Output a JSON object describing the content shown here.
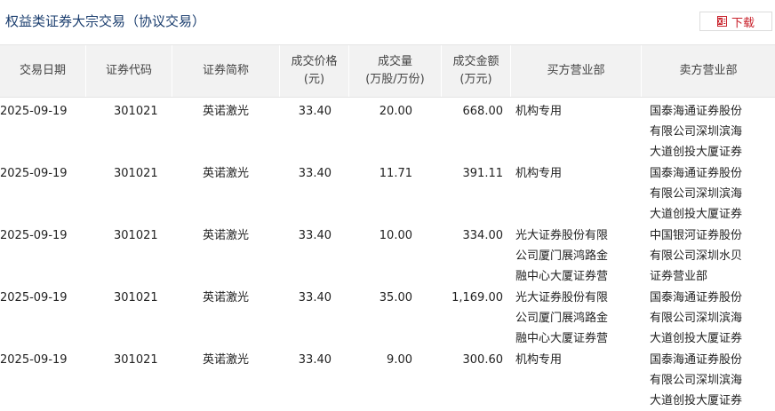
{
  "page": {
    "title": "权益类证券大宗交易（协议交易）"
  },
  "toolbar": {
    "download_label": "下载",
    "download_icon": "excel-file-icon",
    "accent": "#c8202a"
  },
  "table": {
    "headers": [
      [
        "交易日期"
      ],
      [
        "证券代码"
      ],
      [
        "证券简称"
      ],
      [
        "成交价格",
        "(元)"
      ],
      [
        "成交量",
        "(万股/万份)"
      ],
      [
        "成交金额",
        "(万元)"
      ],
      [
        "买方营业部"
      ],
      [
        "卖方营业部"
      ]
    ],
    "rows": [
      {
        "date": "2025-09-19",
        "code": "301021",
        "name": "英诺激光",
        "price": "33.40",
        "volume": "20.00",
        "amount": "668.00",
        "buyer": [
          "机构专用"
        ],
        "seller": [
          "国泰海通证券股份",
          "有限公司深圳滨海",
          "大道创投大厦证券"
        ]
      },
      {
        "date": "2025-09-19",
        "code": "301021",
        "name": "英诺激光",
        "price": "33.40",
        "volume": "11.71",
        "amount": "391.11",
        "buyer": [
          "机构专用"
        ],
        "seller": [
          "国泰海通证券股份",
          "有限公司深圳滨海",
          "大道创投大厦证券"
        ]
      },
      {
        "date": "2025-09-19",
        "code": "301021",
        "name": "英诺激光",
        "price": "33.40",
        "volume": "10.00",
        "amount": "334.00",
        "buyer": [
          "光大证券股份有限",
          "公司厦门展鸿路金",
          "融中心大厦证券营"
        ],
        "seller": [
          "中国银河证券股份",
          "有限公司深圳水贝",
          "证券营业部"
        ]
      },
      {
        "date": "2025-09-19",
        "code": "301021",
        "name": "英诺激光",
        "price": "33.40",
        "volume": "35.00",
        "amount": "1,169.00",
        "buyer": [
          "光大证券股份有限",
          "公司厦门展鸿路金",
          "融中心大厦证券营"
        ],
        "seller": [
          "国泰海通证券股份",
          "有限公司深圳滨海",
          "大道创投大厦证券"
        ]
      },
      {
        "date": "2025-09-19",
        "code": "301021",
        "name": "英诺激光",
        "price": "33.40",
        "volume": "9.00",
        "amount": "300.60",
        "buyer": [
          "机构专用"
        ],
        "seller": [
          "国泰海通证券股份",
          "有限公司深圳滨海",
          "大道创投大厦证券"
        ]
      }
    ]
  }
}
